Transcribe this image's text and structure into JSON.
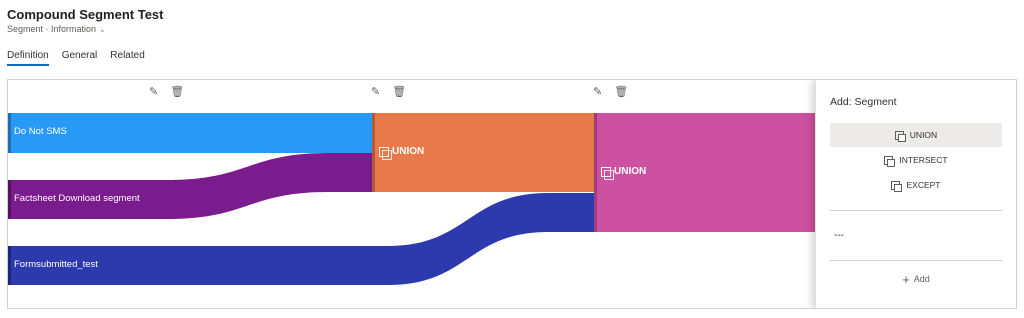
{
  "header": {
    "title": "Compound Segment Test",
    "subtitle": "Segment · Information",
    "subtitle_chevron": "chevron-down-icon"
  },
  "tabs": [
    {
      "label": "Definition",
      "active": true
    },
    {
      "label": "General",
      "active": false
    },
    {
      "label": "Related",
      "active": false
    }
  ],
  "toolbar_icons": [
    "edit-icon",
    "delete-icon"
  ],
  "segments": [
    {
      "label": "Do Not SMS",
      "color": "#2899f5"
    },
    {
      "label": "Factsheet Download segment",
      "color": "#7a1b8e"
    },
    {
      "label": "Formsubmitted_test",
      "color": "#2c3aae"
    }
  ],
  "operations": [
    {
      "label": "UNION",
      "color": "#e8794a"
    },
    {
      "label": "UNION",
      "color": "#cc52a1"
    }
  ],
  "panel": {
    "title": "Add: Segment",
    "options": [
      {
        "label": "UNION",
        "icon": "union-icon",
        "selected": true
      },
      {
        "label": "INTERSECT",
        "icon": "intersect-icon",
        "selected": false
      },
      {
        "label": "EXCEPT",
        "icon": "except-icon",
        "selected": false
      }
    ],
    "placeholder": "---",
    "add_label": "Add"
  }
}
